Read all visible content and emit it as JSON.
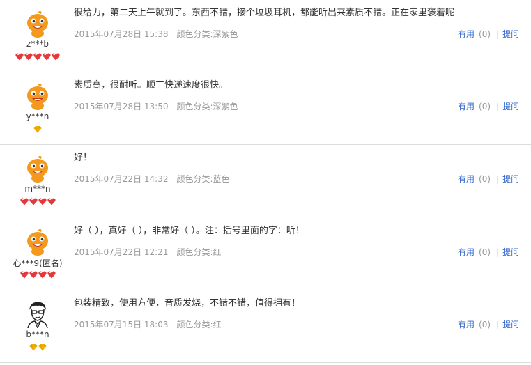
{
  "reviews": [
    {
      "username": "z***b",
      "avatar": "orange-mascot",
      "badge_type": "red-heart",
      "badge_count": 5,
      "content": "很给力，第二天上午就到了。东西不错，接个垃圾耳机，都能听出来素质不错。正在家里褒着呢",
      "date": "2015年07月28日 15:38",
      "sku": "颜色分类:深紫色",
      "useful_label": "有用",
      "useful_count": "(0)",
      "ask_label": "提问"
    },
    {
      "username": "y***n",
      "avatar": "orange-mascot",
      "badge_type": "yellow-diamond",
      "badge_count": 1,
      "content": "素质高，很耐听。顺丰快递速度很快。",
      "date": "2015年07月28日 13:50",
      "sku": "颜色分类:深紫色",
      "useful_label": "有用",
      "useful_count": "(0)",
      "ask_label": "提问"
    },
    {
      "username": "m***n",
      "avatar": "orange-mascot",
      "badge_type": "red-heart",
      "badge_count": 4,
      "content": "好！",
      "date": "2015年07月22日 14:32",
      "sku": "颜色分类:蓝色",
      "useful_label": "有用",
      "useful_count": "(0)",
      "ask_label": "提问"
    },
    {
      "username": "心***9(匿名)",
      "avatar": "orange-mascot",
      "badge_type": "red-heart",
      "badge_count": 4,
      "content": "好（ ），真好（ ），非常好（ ）。注：括号里面的字：听！",
      "date": "2015年07月22日 12:21",
      "sku": "颜色分类:红",
      "useful_label": "有用",
      "useful_count": "(0)",
      "ask_label": "提问"
    },
    {
      "username": "b***n",
      "avatar": "sketch-portrait",
      "badge_type": "yellow-diamond",
      "badge_count": 2,
      "content": "包装精致，使用方便，音质发烧，不错不错，值得拥有！",
      "date": "2015年07月15日 18:03",
      "sku": "颜色分类:红",
      "useful_label": "有用",
      "useful_count": "(0)",
      "ask_label": "提问"
    }
  ],
  "colors": {
    "link": "#3366cc",
    "meta": "#999999",
    "text": "#333333",
    "divider": "#dcdcdc",
    "heart": "#e4393c",
    "diamond": "#f5b301",
    "mascot": "#f39a1e"
  }
}
